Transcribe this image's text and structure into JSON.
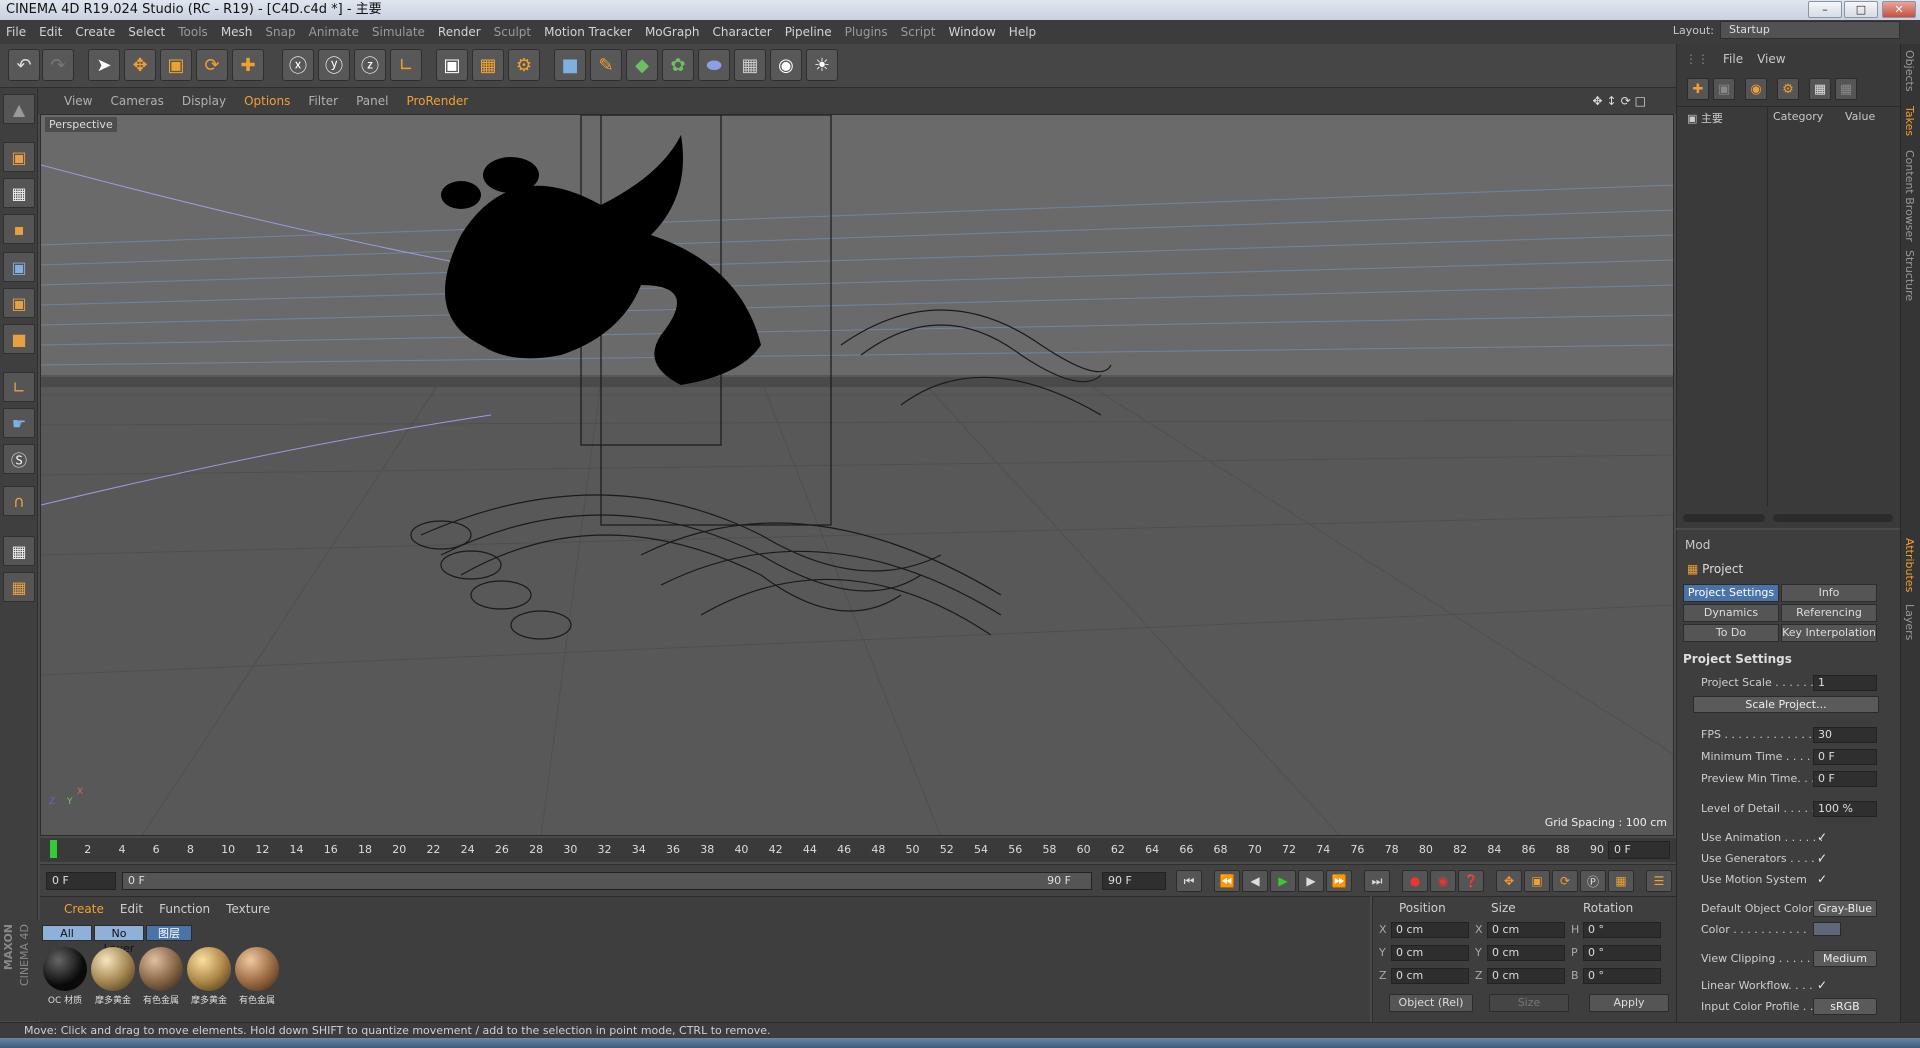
{
  "title_bar": {
    "text": "CINEMA 4D R19.024 Studio (RC - R19) - [C4D.c4d *] - 主要"
  },
  "menubar": {
    "items": [
      "File",
      "Edit",
      "Create",
      "Select",
      "Tools",
      "Mesh",
      "Snap",
      "Animate",
      "Simulate",
      "Render",
      "Sculpt",
      "Motion Tracker",
      "MoGraph",
      "Character",
      "Pipeline",
      "Plugins",
      "Script",
      "Window",
      "Help"
    ],
    "layout_label": "Layout:",
    "layout_value": "Startup"
  },
  "viewport": {
    "menu": [
      "View",
      "Cameras",
      "Display",
      "Options",
      "Filter",
      "Panel",
      "ProRender"
    ],
    "camera_label": "Perspective",
    "grid_spacing": "Grid Spacing : 100 cm",
    "axis_x": "X",
    "axis_y": "Y",
    "axis_z": "Z"
  },
  "timeline": {
    "ticks": [
      "0",
      "2",
      "4",
      "6",
      "8",
      "10",
      "12",
      "14",
      "16",
      "18",
      "20",
      "22",
      "24",
      "26",
      "28",
      "30",
      "32",
      "34",
      "36",
      "38",
      "40",
      "42",
      "44",
      "46",
      "48",
      "50",
      "52",
      "54",
      "56",
      "58",
      "60",
      "62",
      "64",
      "66",
      "68",
      "70",
      "72",
      "74",
      "76",
      "78",
      "80",
      "82",
      "84",
      "86",
      "88",
      "90"
    ],
    "current_frame": "0 F",
    "start_frame": "0 F",
    "range_start": "0 F",
    "range_end": "90 F",
    "end_frame": "90 F"
  },
  "materials": {
    "menu": [
      "Create",
      "Edit",
      "Function",
      "Texture"
    ],
    "filters": [
      "All",
      "No Layer",
      "图层"
    ],
    "items": [
      {
        "name": "OC 材质",
        "color": "#0a0a0a"
      },
      {
        "name": "摩多黄金",
        "color": "#a88a55"
      },
      {
        "name": "有色金属",
        "color": "#8a6a4a"
      },
      {
        "name": "摩多黄金",
        "color": "#b08a4a"
      },
      {
        "name": "有色金属",
        "color": "#a07048"
      }
    ],
    "brand_line1": "MAXON",
    "brand_line2": "CINEMA 4D"
  },
  "coordinates": {
    "headers": [
      "Position",
      "Size",
      "Rotation"
    ],
    "rows": [
      {
        "p_axis": "X",
        "p": "0 cm",
        "s_axis": "X",
        "s": "0 cm",
        "r_axis": "H",
        "r": "0 °"
      },
      {
        "p_axis": "Y",
        "p": "0 cm",
        "s_axis": "Y",
        "s": "0 cm",
        "r_axis": "P",
        "r": "0 °"
      },
      {
        "p_axis": "Z",
        "p": "0 cm",
        "s_axis": "Z",
        "s": "0 cm",
        "r_axis": "B",
        "r": "0 °"
      }
    ],
    "mode": "Object (Rel)",
    "size_mode": "Size",
    "apply": "Apply"
  },
  "status": {
    "text": "Move: Click and drag to move elements. Hold down SHIFT to quantize movement / add to the selection in point mode, CTRL to remove."
  },
  "object_manager": {
    "menu": [
      "File",
      "View"
    ],
    "take_name": "主要",
    "col_category": "Category",
    "col_value": "Value"
  },
  "attributes": {
    "mode": "Mod",
    "object": "Project",
    "tabs": [
      "Project Settings",
      "Info",
      "Dynamics",
      "Referencing",
      "To Do",
      "Key Interpolation"
    ],
    "section": "Project Settings",
    "fields": {
      "project_scale_label": "Project Scale . . . . . .",
      "project_scale": "1",
      "scale_project_btn": "Scale Project...",
      "fps_label": "FPS . . . . . . . . . . . . . . .",
      "fps": "30",
      "min_time_label": "Minimum Time . . . .",
      "min_time": "0 F",
      "preview_min_label": "Preview Min Time. . .",
      "preview_min": "0 F",
      "lod_label": "Level of Detail . . . . .",
      "lod": "100 %",
      "use_animation": "Use Animation . . . . . .",
      "use_generators": "Use Generators . . . . .",
      "use_motion": "Use Motion System",
      "check": "✓",
      "default_color_label": "Default Object Color",
      "default_color": "Gray-Blue",
      "color_label": "Color . . . . . . . . . . .",
      "view_clipping_label": "View Clipping . . . . .",
      "view_clipping": "Medium",
      "linear_workflow": "Linear Workflow. . . .",
      "input_profile_label": "Input Color Profile . .",
      "input_profile": "sRGB"
    }
  },
  "right_tabs": [
    "Objects",
    "Takes",
    "Content Browser",
    "Structure",
    "Attributes",
    "Layers"
  ]
}
